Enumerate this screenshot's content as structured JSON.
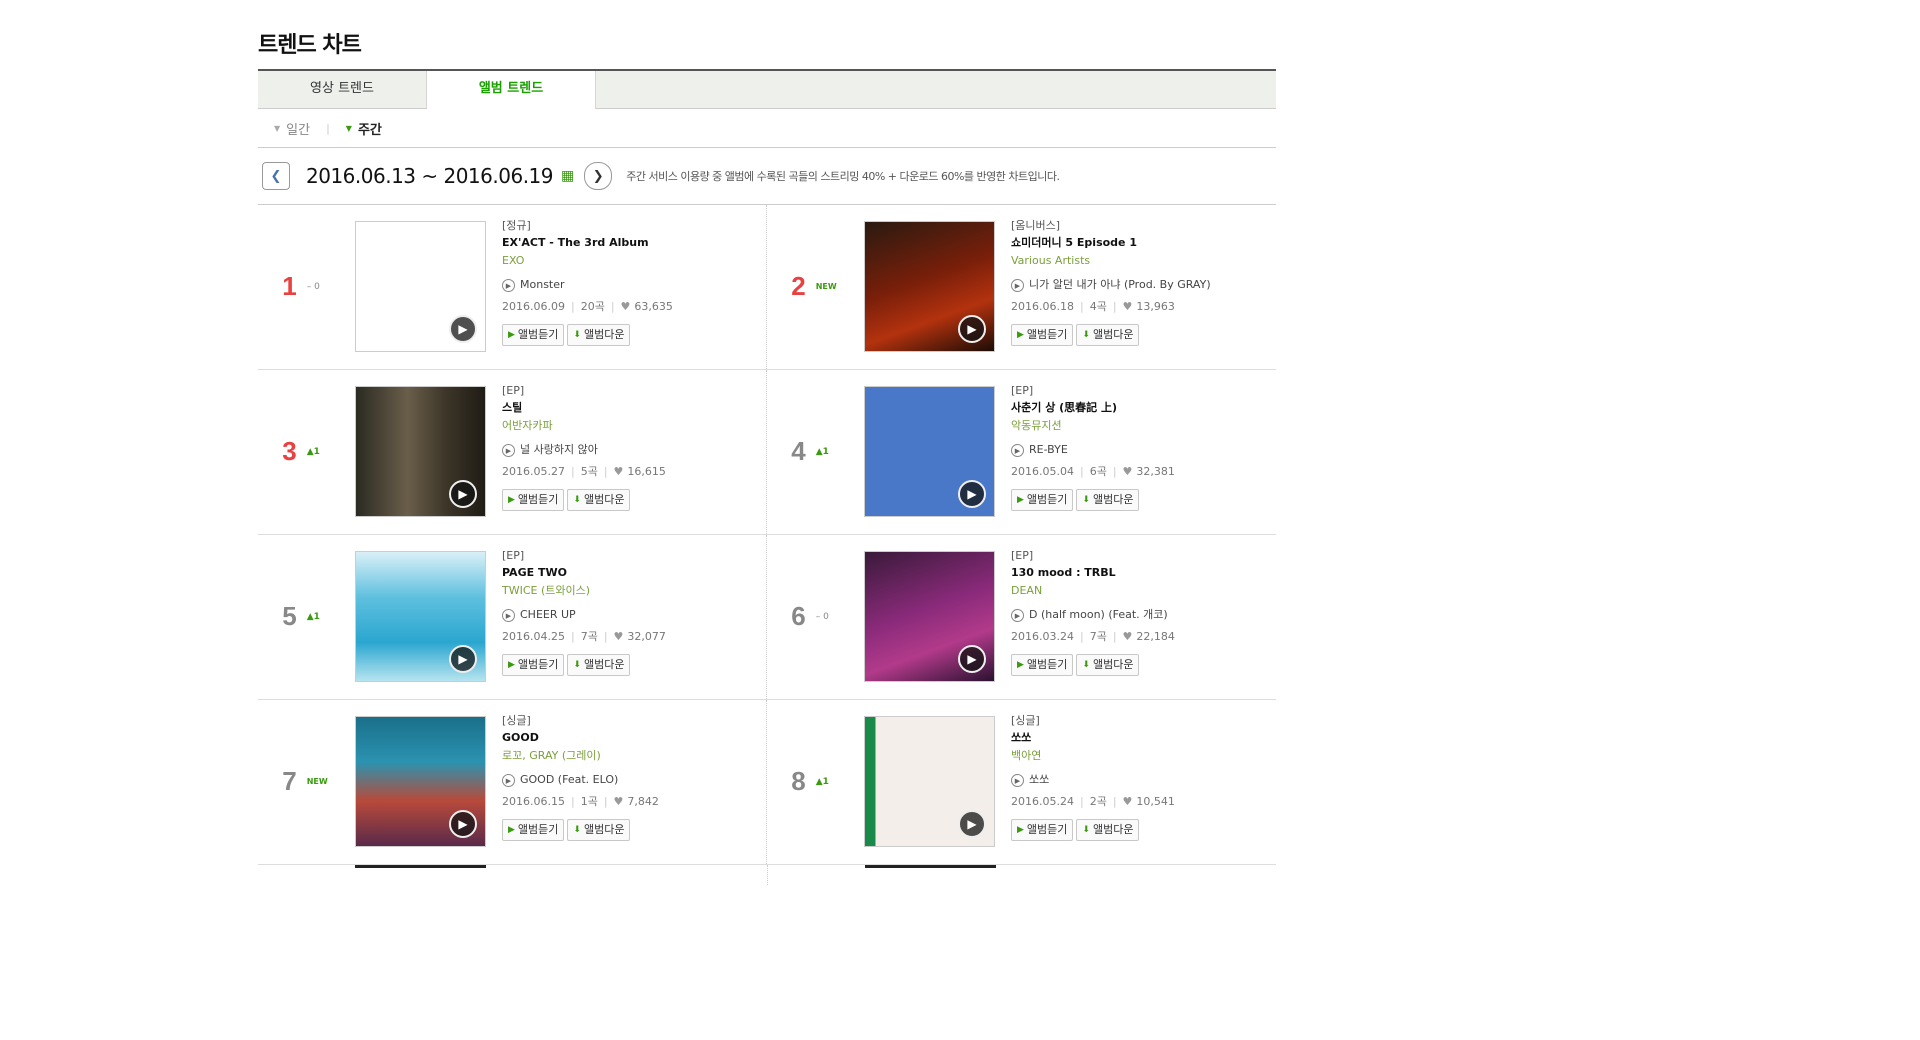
{
  "page": {
    "title": "트렌드 차트"
  },
  "tabs": [
    {
      "label": "영상 트렌드",
      "active": false
    },
    {
      "label": "앨범 트렌드",
      "active": true
    }
  ],
  "period": {
    "daily": "일간",
    "weekly": "주간",
    "selected": "주간"
  },
  "date_bar": {
    "range": "2016.06.13 ~ 2016.06.19",
    "note": "주간 서비스 이용량 중 앨범에 수록된 곡들의 스트리밍 40% + 다운로드 60%를 반영한 차트입니다."
  },
  "buttons": {
    "listen": "앨범듣기",
    "download": "앨범다운"
  },
  "colors": {
    "accent": "#1aa100",
    "rank_top": "#e94141",
    "artist": "#7aa03a"
  },
  "albums": [
    {
      "rank": "1",
      "change": "– 0",
      "change_type": "same",
      "type": "[정규]",
      "title": "EX'ACT - The 3rd Album",
      "artist": "EXO",
      "song": "Monster",
      "date": "2016.06.09",
      "tracks": "20곡",
      "likes": "63,635"
    },
    {
      "rank": "2",
      "change": "NEW",
      "change_type": "new",
      "type": "[옴니버스]",
      "title": "쇼미더머니 5 Episode 1",
      "artist": "Various Artists",
      "song": "니가 알던 내가 아냐 (Prod. By GRAY)",
      "date": "2016.06.18",
      "tracks": "4곡",
      "likes": "13,963"
    },
    {
      "rank": "3",
      "change": "▲1",
      "change_type": "up",
      "type": "[EP]",
      "title": "스틸",
      "artist": "어반자카파",
      "song": "널 사랑하지 않아",
      "date": "2016.05.27",
      "tracks": "5곡",
      "likes": "16,615"
    },
    {
      "rank": "4",
      "change": "▲1",
      "change_type": "up",
      "type": "[EP]",
      "title": "사춘기 상 (思春記 上)",
      "artist": "악동뮤지션",
      "song": "RE-BYE",
      "date": "2016.05.04",
      "tracks": "6곡",
      "likes": "32,381"
    },
    {
      "rank": "5",
      "change": "▲1",
      "change_type": "up",
      "type": "[EP]",
      "title": "PAGE TWO",
      "artist": "TWICE (트와이스)",
      "song": "CHEER UP",
      "date": "2016.04.25",
      "tracks": "7곡",
      "likes": "32,077"
    },
    {
      "rank": "6",
      "change": "– 0",
      "change_type": "same",
      "type": "[EP]",
      "title": "130 mood : TRBL",
      "artist": "DEAN",
      "song": "D (half moon) (Feat. 개코)",
      "date": "2016.03.24",
      "tracks": "7곡",
      "likes": "22,184"
    },
    {
      "rank": "7",
      "change": "NEW",
      "change_type": "new",
      "type": "[싱글]",
      "title": "GOOD",
      "artist": "로꼬, GRAY (그레이)",
      "song": "GOOD (Feat. ELO)",
      "date": "2016.06.15",
      "tracks": "1곡",
      "likes": "7,842"
    },
    {
      "rank": "8",
      "change": "▲1",
      "change_type": "up",
      "type": "[싱글]",
      "title": "쏘쏘",
      "artist": "백아연",
      "song": "쏘쏘",
      "date": "2016.05.24",
      "tracks": "2곡",
      "likes": "10,541"
    }
  ]
}
